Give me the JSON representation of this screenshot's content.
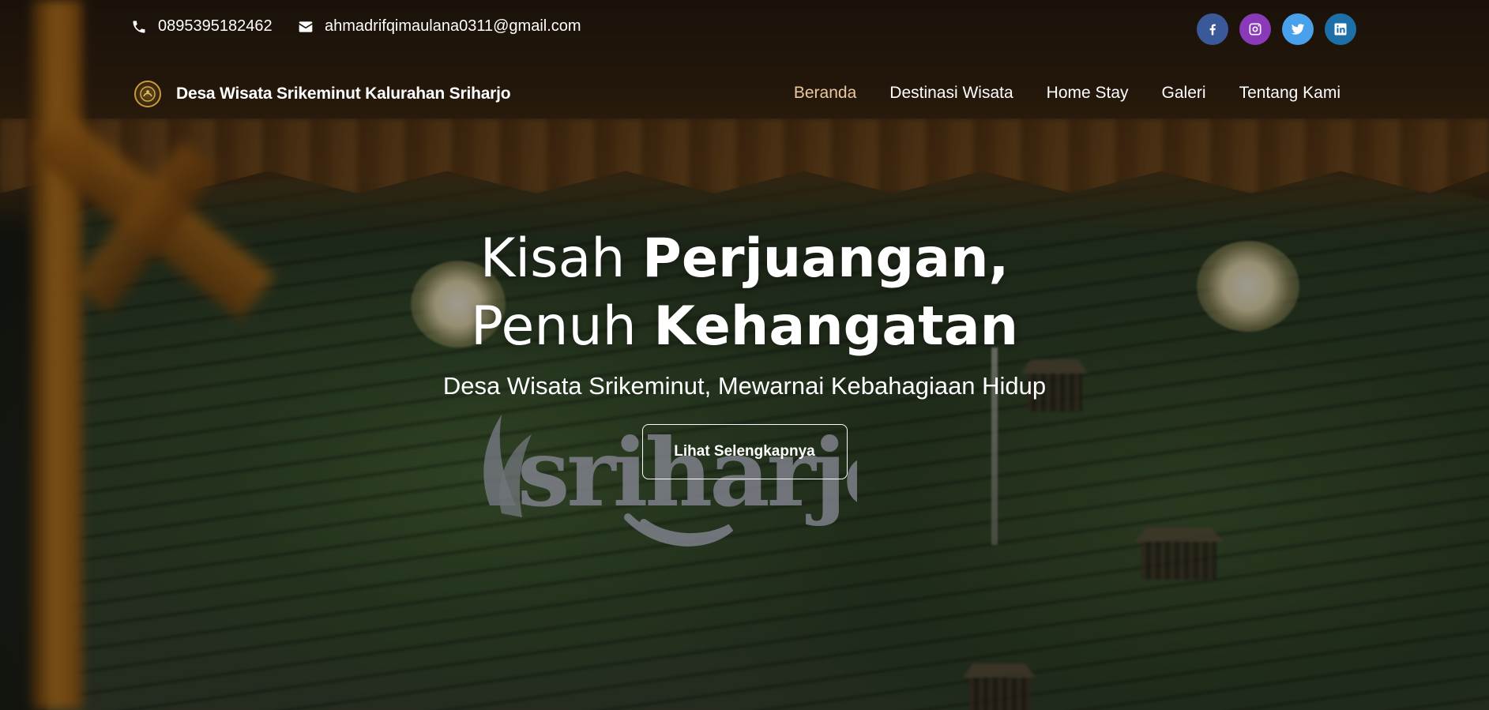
{
  "topbar": {
    "phone": "0895395182462",
    "email": "ahmadrifqimaulana0311@gmail.com",
    "socials": [
      {
        "name": "facebook-icon",
        "color": "#3b5998"
      },
      {
        "name": "instagram-icon",
        "color": "#8a3ab9"
      },
      {
        "name": "twitter-icon",
        "color": "#4aa1eb"
      },
      {
        "name": "linkedin-icon",
        "color": "#1d6fa8"
      }
    ]
  },
  "navbar": {
    "brand": "Desa Wisata Srikeminut Kalurahan Sriharjo",
    "links": [
      {
        "label": "Beranda",
        "active": true
      },
      {
        "label": "Destinasi Wisata",
        "active": false
      },
      {
        "label": "Home Stay",
        "active": false
      },
      {
        "label": "Galeri",
        "active": false
      },
      {
        "label": "Tentang Kami",
        "active": false
      }
    ],
    "active_color": "#e9c89d"
  },
  "hero": {
    "line1_regular": "Kisah",
    "line1_bold": "Perjuangan,",
    "line2_regular": "Penuh",
    "line2_bold": "Kehangatan",
    "subtitle": "Desa Wisata Srikeminut, Mewarnai Kebahagiaan Hidup",
    "cta_label": "Lihat Selengkapnya"
  },
  "background": {
    "sign_text": "sriharjo"
  }
}
